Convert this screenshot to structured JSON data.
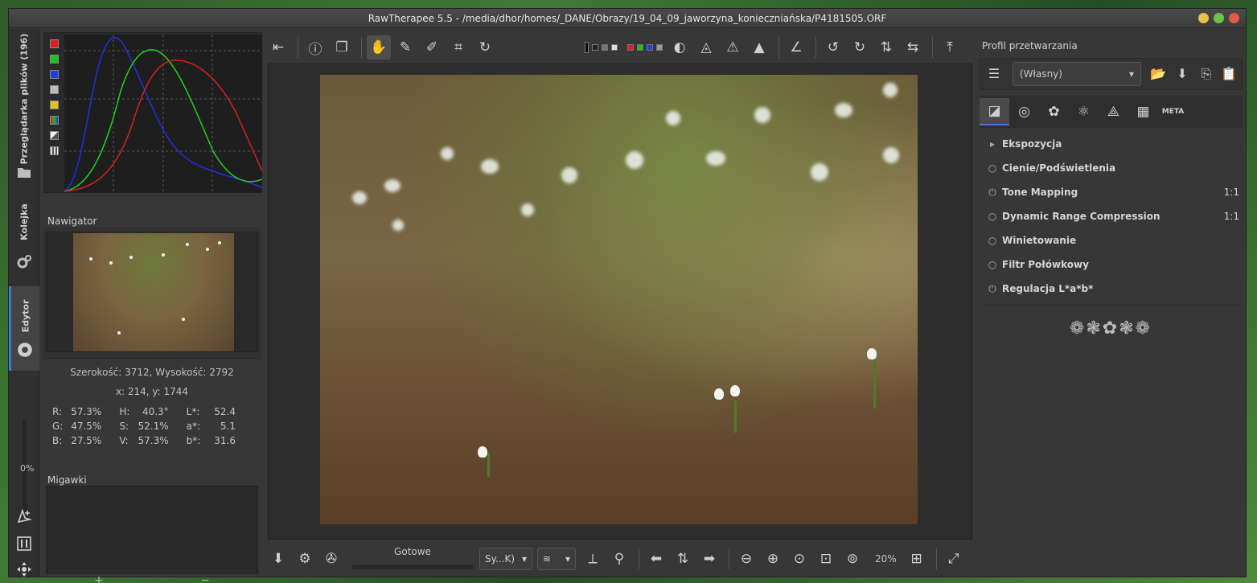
{
  "window": {
    "title": "RawTherapee 5.5 - /media/dhor/homes/_DANE/Obrazy/19_04_09_jaworzyna_konieczniańska/P4181505.ORF"
  },
  "vtabs": {
    "browser": "Przeglądarka plików (196)",
    "queue": "Kolejka",
    "editor": "Edytor",
    "percent": "0%"
  },
  "navigator": {
    "title": "Nawigator",
    "dimensions": "Szerokość: 3712, Wysokość: 2792",
    "coords": "x: 214, y: 1744",
    "values": [
      {
        "k1": "R:",
        "v1": "57.3%",
        "k2": "H:",
        "v2": "40.3°",
        "k3": "L*:",
        "v3": "52.4"
      },
      {
        "k1": "G:",
        "v1": "47.5%",
        "k2": "S:",
        "v2": "52.1%",
        "k3": "a*:",
        "v3": "5.1"
      },
      {
        "k1": "B:",
        "v1": "27.5%",
        "k2": "V:",
        "v2": "57.3%",
        "k3": "b*:",
        "v3": "31.6"
      }
    ]
  },
  "snapshots": {
    "title": "Migawki",
    "add": "+",
    "remove": "−"
  },
  "bottom": {
    "status": "Gotowe",
    "preview_mode": "Sy...K)",
    "zoom": "20%"
  },
  "profile": {
    "title": "Profil przetwarzania",
    "selected": "(Własny)"
  },
  "tooltabs": {
    "meta_label": "META"
  },
  "tools": [
    {
      "icon": "▸",
      "label": "Ekspozycja",
      "right": ""
    },
    {
      "icon": "○",
      "label": "Cienie/Podświetlenia",
      "right": ""
    },
    {
      "icon": "⏻",
      "label": "Tone Mapping",
      "right": "1:1"
    },
    {
      "icon": "○",
      "label": "Dynamic Range Compression",
      "right": "1:1"
    },
    {
      "icon": "○",
      "label": "Winietowanie",
      "right": ""
    },
    {
      "icon": "○",
      "label": "Filtr Połówkowy",
      "right": ""
    },
    {
      "icon": "⏻",
      "label": "Regulacja L*a*b*",
      "right": ""
    }
  ],
  "colors": {
    "accent": "#3a7bd5",
    "hist_red": "#d22020",
    "hist_green": "#20d020",
    "hist_blue": "#2030e0"
  }
}
